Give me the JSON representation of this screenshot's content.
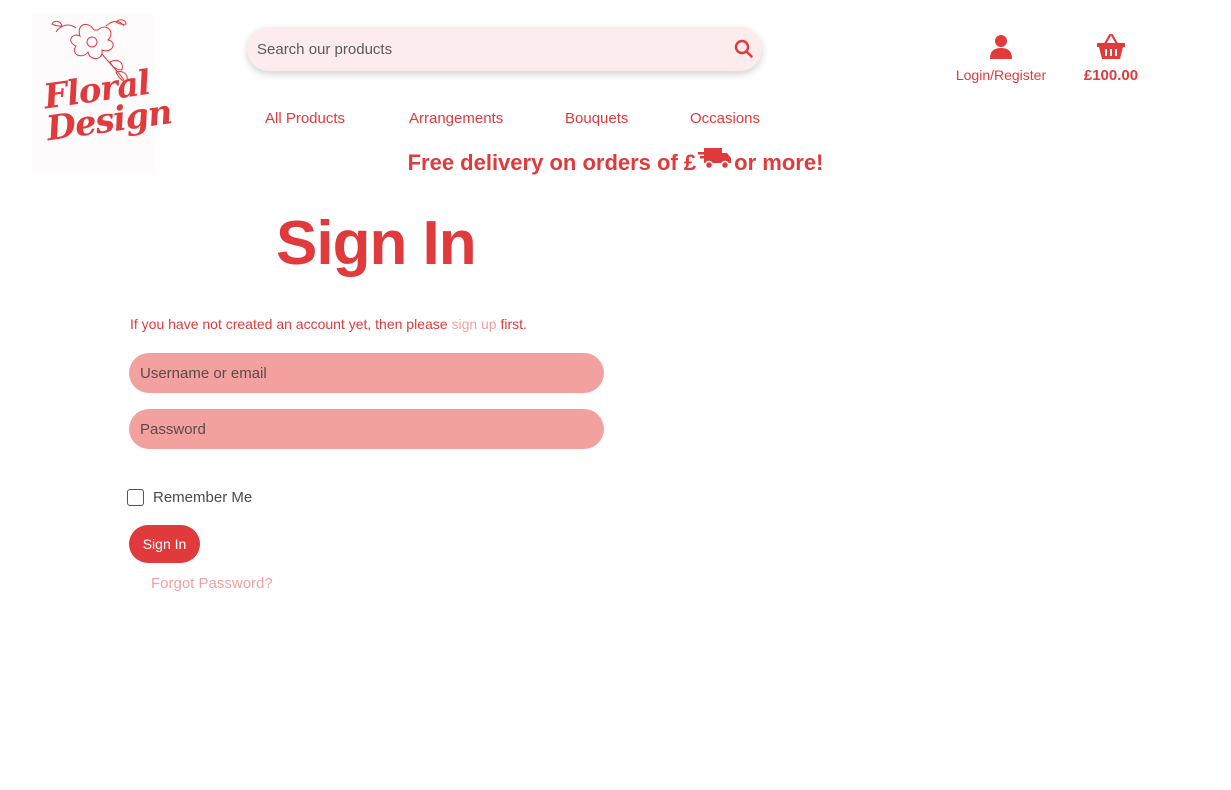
{
  "brand": {
    "logo_text_line1": "Floral",
    "logo_text_line2": "Design",
    "accent_color": "#e03a3c",
    "input_color": "#f2a19f",
    "link_color": "#f0a1a2"
  },
  "search": {
    "placeholder": "Search our products",
    "icon": "search-icon"
  },
  "nav": {
    "items": [
      {
        "label": "All Products"
      },
      {
        "label": "Arrangements"
      },
      {
        "label": "Bouquets"
      },
      {
        "label": "Occasions"
      }
    ]
  },
  "account": {
    "icon": "user-icon",
    "label": "Login/Register"
  },
  "basket": {
    "icon": "basket-icon",
    "amount": "£100.00"
  },
  "promo": {
    "text_before": "Free delivery on orders of £",
    "text_after": " or more!",
    "icon": "truck-icon"
  },
  "signin": {
    "title": "Sign In",
    "info_before": "If you have not created an account yet, then please ",
    "info_link": "sign up",
    "info_after": " first.",
    "username_placeholder": "Username or email",
    "password_placeholder": "Password",
    "remember_label": "Remember Me",
    "submit_label": "Sign In",
    "forgot_label": "Forgot Password?"
  }
}
